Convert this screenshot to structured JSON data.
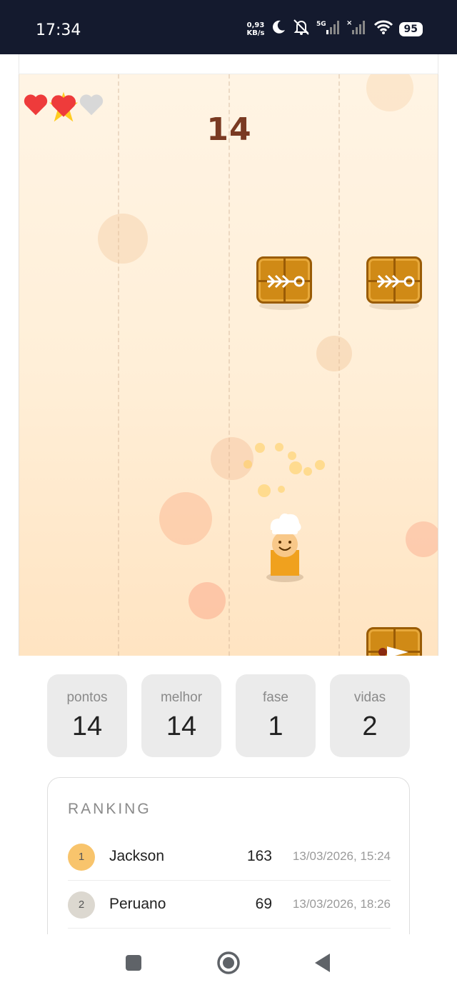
{
  "status_bar": {
    "time": "17:34",
    "net_speed_value": "0,93",
    "net_speed_unit": "KB/s",
    "network_label": "5G",
    "battery": "95"
  },
  "game": {
    "score": "14",
    "lives_icons": [
      "heart-red",
      "heart-red-star",
      "heart-grey"
    ],
    "colors": {
      "background_top": "#fff4e4",
      "background_bottom": "#ffe4c2",
      "crate": "#d08a16",
      "score_text": "#7a3a22"
    }
  },
  "stats": [
    {
      "label": "pontos",
      "value": "14"
    },
    {
      "label": "melhor",
      "value": "14"
    },
    {
      "label": "fase",
      "value": "1"
    },
    {
      "label": "vidas",
      "value": "2"
    }
  ],
  "ranking": {
    "title": "RANKING",
    "rows": [
      {
        "rank": "1",
        "name": "Jackson",
        "points": "163",
        "date": "13/03/2026, 15:24",
        "badge_color": "#f8c46c"
      },
      {
        "rank": "2",
        "name": "Peruano",
        "points": "69",
        "date": "13/03/2026, 18:26",
        "badge_color": "#dcd8d0"
      }
    ]
  },
  "nav": {
    "icons": [
      "recents-square-icon",
      "home-circle-icon",
      "back-triangle-icon"
    ]
  }
}
